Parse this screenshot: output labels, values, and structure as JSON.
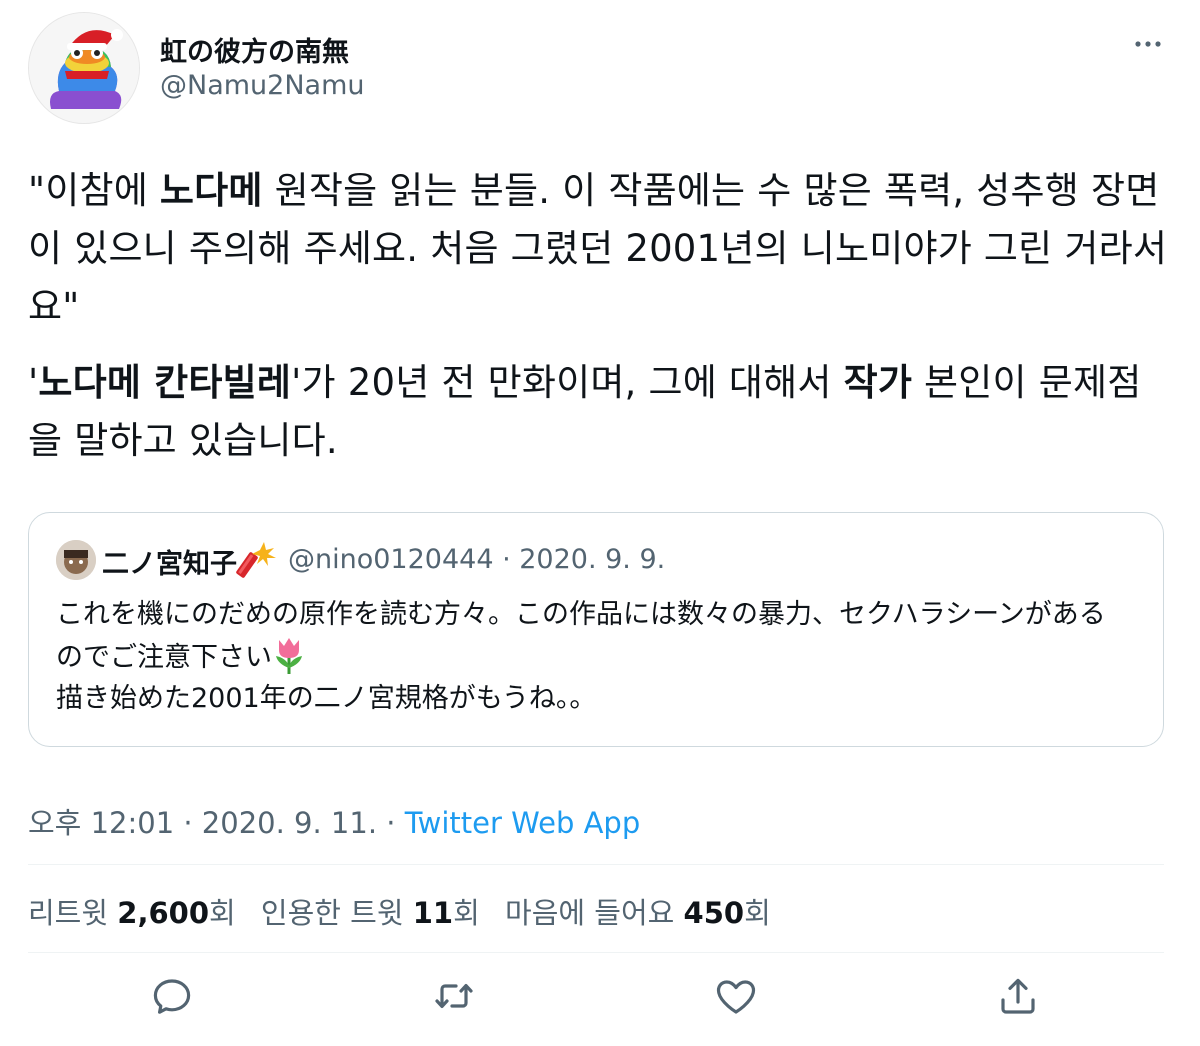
{
  "author": {
    "display_name": "虹の彼方の南無",
    "handle": "@Namu2Namu"
  },
  "tweet": {
    "p1": [
      {
        "t": "\"이참에 ",
        "b": false
      },
      {
        "t": "노다메",
        "b": true
      },
      {
        "t": " 원작을 읽는 분들. 이 작품에는 수 많은 폭력, 성추행 장면이 있으니 주의해 주세요. 처음 그렸던 2001년의 니노미야가 그린 거라서요\"",
        "b": false
      }
    ],
    "p2": [
      {
        "t": "'",
        "b": false
      },
      {
        "t": "노다메 칸타빌레",
        "b": true
      },
      {
        "t": "'가 20년 전 만화이며, 그에 대해서 ",
        "b": false
      },
      {
        "t": "작가",
        "b": true
      },
      {
        "t": " 본인이 문제점을 말하고 있습니다.",
        "b": false
      }
    ]
  },
  "quote": {
    "name": "二ノ宮知子",
    "handle_date": "@nino0120444 · 2020. 9. 9.",
    "line1": "これを機にのだめの原作を読む方々。この作品には数々の暴力、セクハラシーンがある",
    "line2": "のでご注意下さい",
    "line3": "描き始めた2001年の二ノ宮規格がもうね。。"
  },
  "meta": {
    "time_date": "오후 12:01 · 2020. 9. 11. · ",
    "app": "Twitter Web App"
  },
  "stats": {
    "retweets_label": "리트윗",
    "retweets_count": "2,600",
    "retweets_unit": "회",
    "quotes_label": "인용한 트윗",
    "quotes_count": "11",
    "quotes_unit": "회",
    "likes_label": "마음에 들어요",
    "likes_count": "450",
    "likes_unit": "회"
  },
  "icons": {
    "more": "more-horizontal-icon",
    "reply": "reply-icon",
    "retweet": "retweet-icon",
    "like": "heart-icon",
    "share": "share-icon",
    "tulip": "tulip-emoji",
    "firecracker": "firecracker-emoji"
  },
  "colors": {
    "text": "#0f1419",
    "secondary": "#536471",
    "link": "#1d9bf0",
    "border": "#cfd9de"
  }
}
